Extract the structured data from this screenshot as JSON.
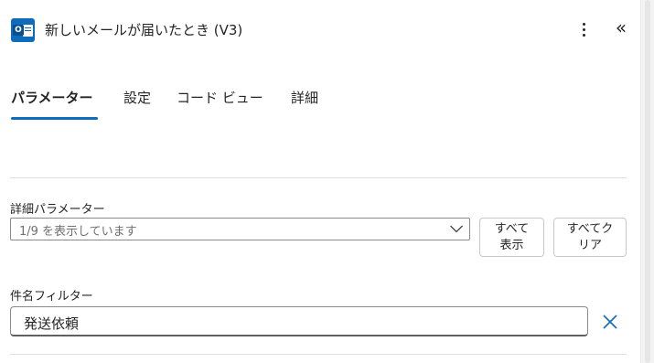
{
  "header": {
    "title": "新しいメールが届いたとき (V3)",
    "app_icon_letter": "O",
    "app_icon": "outlook-icon",
    "more_icon": "more-vertical-icon",
    "collapse_glyph": "«",
    "collapse_icon": "double-chevron-left-icon"
  },
  "tabs": [
    {
      "label": "パラメーター",
      "active": true
    },
    {
      "label": "設定",
      "active": false
    },
    {
      "label": "コード ビュー",
      "active": false
    },
    {
      "label": "詳細",
      "active": false
    }
  ],
  "advanced_params": {
    "label": "詳細パラメーター",
    "dropdown_value": "1/9 を表示しています",
    "show_all_line1": "すべて",
    "show_all_line2": "表示",
    "clear_all_line1": "すべてク",
    "clear_all_line2": "リア"
  },
  "subject_filter": {
    "label": "件名フィルター",
    "value": "発送依頼",
    "remove_icon": "close-icon"
  },
  "colors": {
    "accent": "#0f6cbd",
    "text": "#242424",
    "placeholder": "#707070",
    "border": "#8a8a8a"
  }
}
